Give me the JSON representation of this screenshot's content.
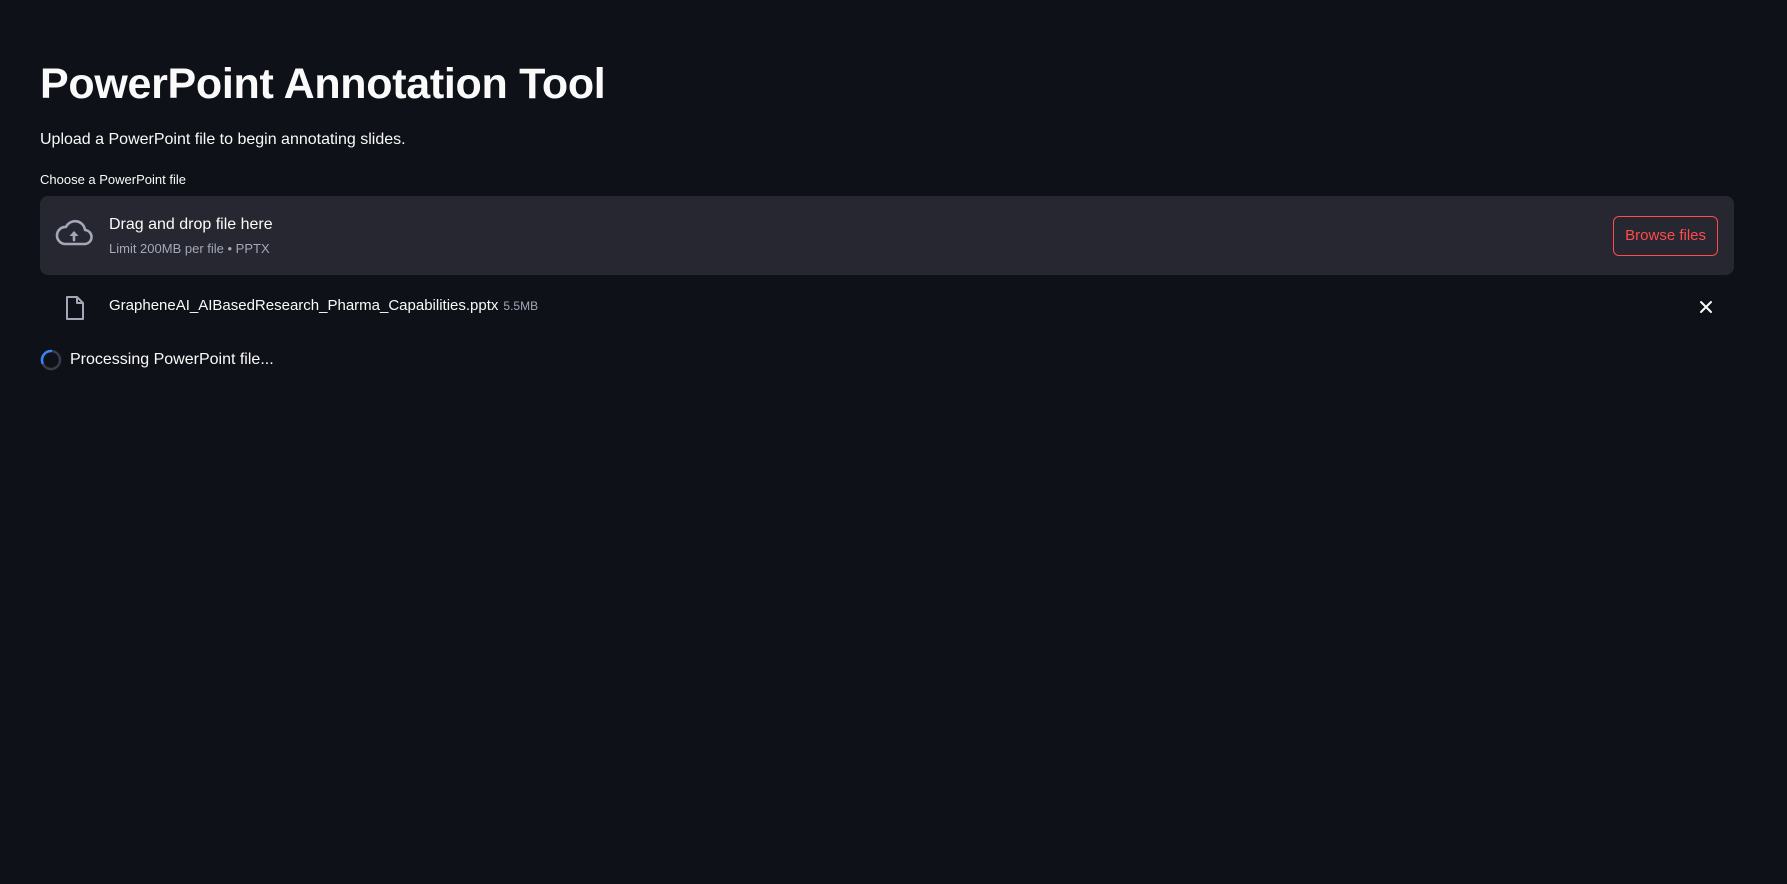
{
  "page": {
    "title": "PowerPoint Annotation Tool",
    "intro": "Upload a PowerPoint file to begin annotating slides."
  },
  "uploader": {
    "label": "Choose a PowerPoint file",
    "dropzone_title": "Drag and drop file here",
    "dropzone_limit": "Limit 200MB per file • PPTX",
    "browse_label": "Browse files",
    "icon": "cloud-upload-icon"
  },
  "uploaded_file": {
    "name": "GrapheneAI_AIBasedResearch_Pharma_Capabilities.pptx",
    "size": "5.5MB",
    "icon": "file-icon",
    "remove_icon": "close-icon"
  },
  "status": {
    "text": "Processing PowerPoint file...",
    "icon": "spinner-icon"
  },
  "colors": {
    "background": "#0e1117",
    "surface": "#262730",
    "accent": "#ff4b4b",
    "text": "#fafafa",
    "muted": "#a3a8b8",
    "spinner": "#3b82f6"
  }
}
